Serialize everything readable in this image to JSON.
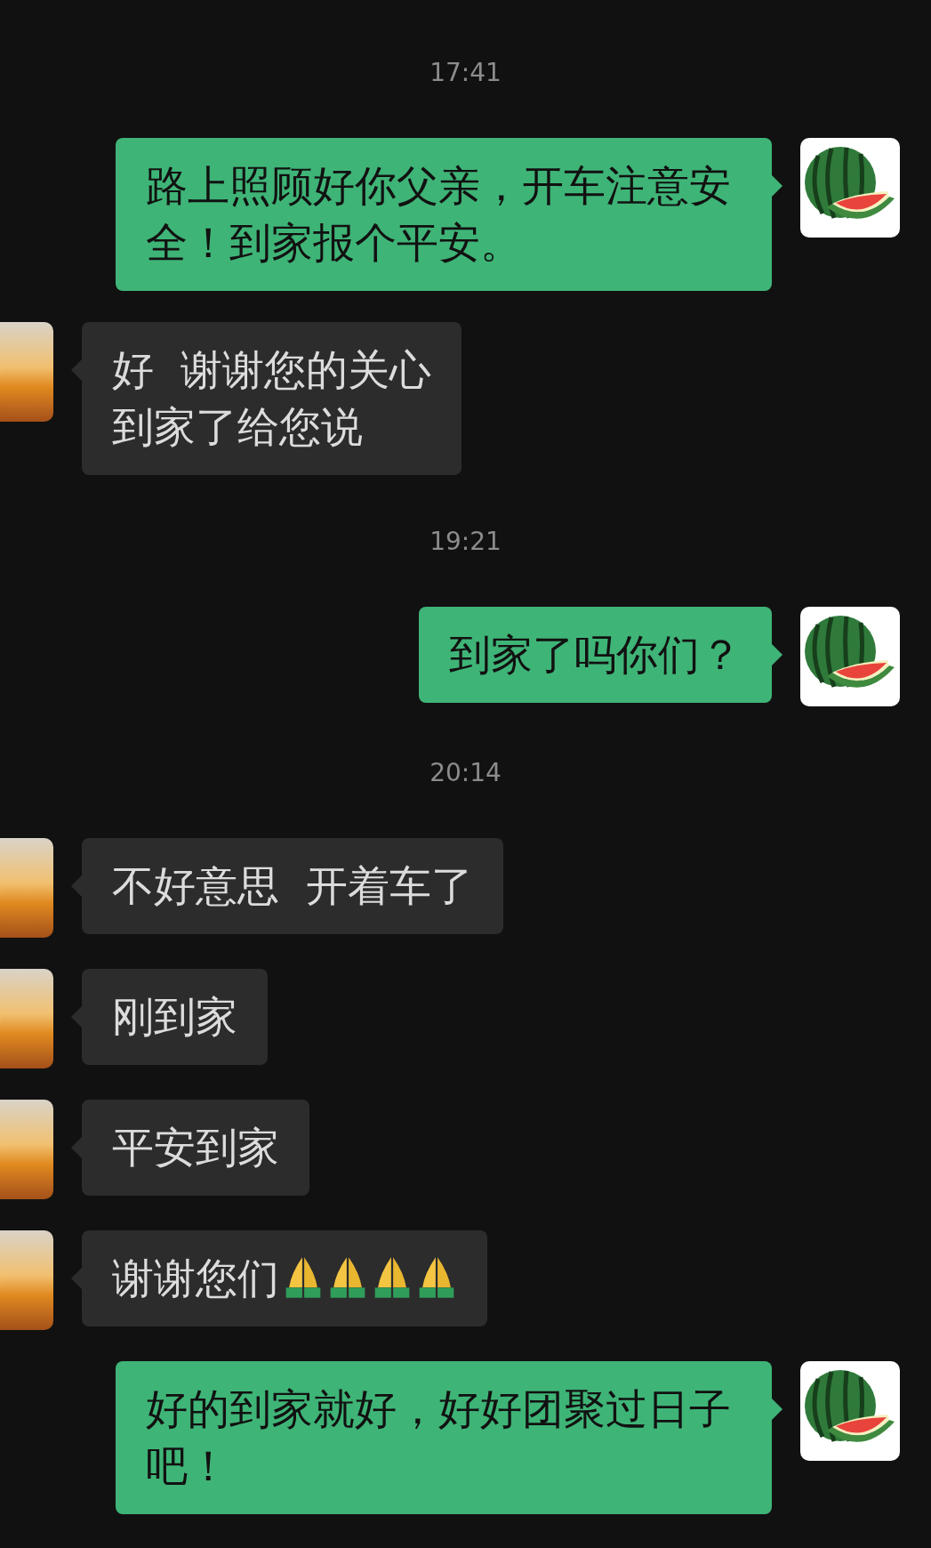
{
  "messages": [
    {
      "kind": "time",
      "text": "17:41"
    },
    {
      "kind": "sent",
      "text": "路上照顾好你父亲，开车注意安全！到家报个平安。"
    },
    {
      "kind": "received",
      "lines": [
        "好  谢谢您的关心",
        "到家了给您说"
      ]
    },
    {
      "kind": "time",
      "text": "19:21"
    },
    {
      "kind": "sent",
      "text": "到家了吗你们？"
    },
    {
      "kind": "time",
      "text": "20:14"
    },
    {
      "kind": "received",
      "text": "不好意思  开着车了"
    },
    {
      "kind": "received",
      "text": "刚到家"
    },
    {
      "kind": "received",
      "text": "平安到家"
    },
    {
      "kind": "received",
      "text": "谢谢您们",
      "emoji": [
        {
          "kind": "praying-hands"
        },
        {
          "kind": "praying-hands"
        },
        {
          "kind": "praying-hands"
        },
        {
          "kind": "praying-hands"
        }
      ]
    },
    {
      "kind": "sent",
      "text": "好的到家就好，好好团聚过日子吧！"
    }
  ]
}
